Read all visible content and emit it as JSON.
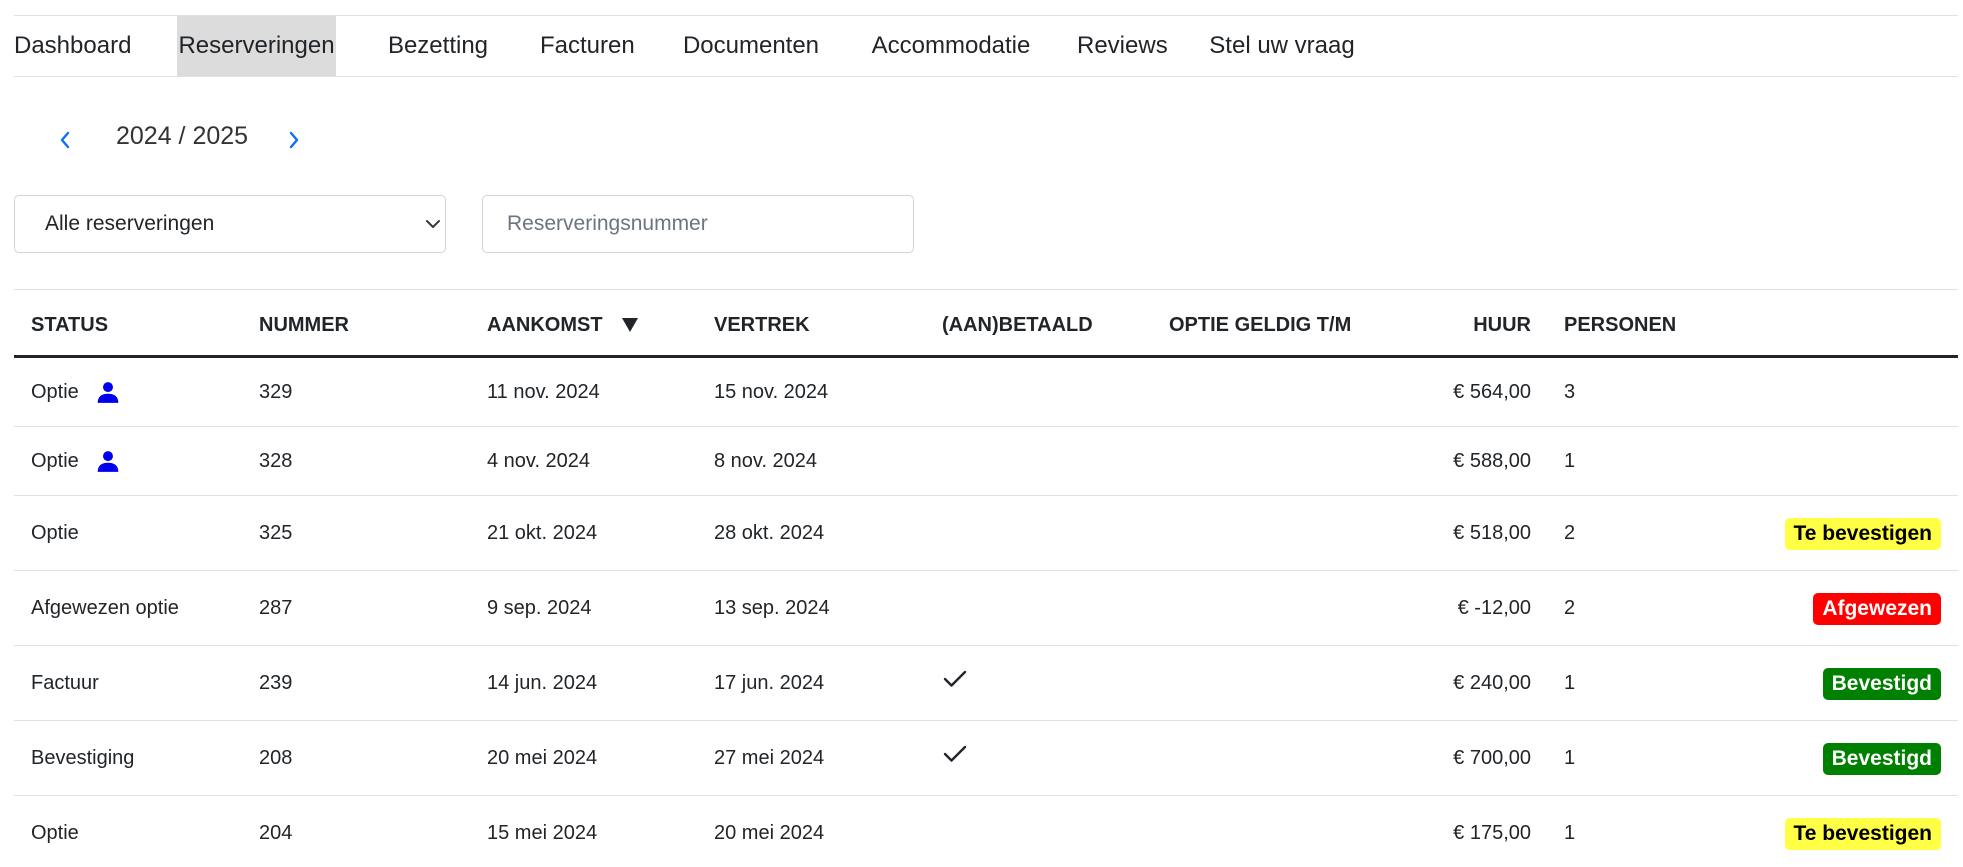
{
  "nav": {
    "tabs": [
      {
        "label": "Dashboard"
      },
      {
        "label": "Reserveringen"
      },
      {
        "label": "Bezetting"
      },
      {
        "label": "Facturen"
      },
      {
        "label": "Documenten"
      },
      {
        "label": "Accommodatie"
      },
      {
        "label": "Reviews"
      },
      {
        "label": "Stel uw vraag"
      }
    ],
    "active_tab": "Reserveringen"
  },
  "season": {
    "label": "2024 / 2025",
    "prev_icon": "chevron-left-icon",
    "next_icon": "chevron-right-icon"
  },
  "filters": {
    "status_select": {
      "selected": "Alle reserveringen"
    },
    "search": {
      "placeholder": "Reserveringsnummer",
      "value": ""
    }
  },
  "table": {
    "headers": {
      "status": "Status",
      "nummer": "Nummer",
      "aankomst": "Aankomst",
      "vertrek": "Vertrek",
      "betaald": "(Aan)betaald",
      "optie": "Optie geldig t/m",
      "huur": "Huur",
      "personen": "Personen"
    },
    "sort": {
      "column": "aankomst",
      "direction": "desc",
      "icon": "sort-down-icon"
    },
    "rows": [
      {
        "status": "Optie",
        "owner_icon": true,
        "nummer": "329",
        "aankomst": "11 nov. 2024",
        "vertrek": "15 nov. 2024",
        "betaald": false,
        "huur": "€ 564,00",
        "personen": "3",
        "badge": null
      },
      {
        "status": "Optie",
        "owner_icon": true,
        "nummer": "328",
        "aankomst": "4 nov. 2024",
        "vertrek": "8 nov. 2024",
        "betaald": false,
        "huur": "€ 588,00",
        "personen": "1",
        "badge": null
      },
      {
        "status": "Optie",
        "owner_icon": false,
        "nummer": "325",
        "aankomst": "21 okt. 2024",
        "vertrek": "28 okt. 2024",
        "betaald": false,
        "huur": "€ 518,00",
        "personen": "2",
        "badge": {
          "label": "Te bevestigen",
          "bg": "#ffff45",
          "fg": "#000000"
        }
      },
      {
        "status": "Afgewezen optie",
        "owner_icon": false,
        "nummer": "287",
        "aankomst": "9 sep. 2024",
        "vertrek": "13 sep. 2024",
        "betaald": false,
        "huur": "€ -12,00",
        "personen": "2",
        "badge": {
          "label": "Afgewezen",
          "bg": "#ff0000",
          "fg": "#ffffff"
        }
      },
      {
        "status": "Factuur",
        "owner_icon": false,
        "nummer": "239",
        "aankomst": "14 jun. 2024",
        "vertrek": "17 jun. 2024",
        "betaald": true,
        "huur": "€ 240,00",
        "personen": "1",
        "badge": {
          "label": "Bevestigd",
          "bg": "#008000",
          "fg": "#ffffff"
        }
      },
      {
        "status": "Bevestiging",
        "owner_icon": false,
        "nummer": "208",
        "aankomst": "20 mei 2024",
        "vertrek": "27 mei 2024",
        "betaald": true,
        "huur": "€ 700,00",
        "personen": "1",
        "badge": {
          "label": "Bevestigd",
          "bg": "#008000",
          "fg": "#ffffff"
        }
      },
      {
        "status": "Optie",
        "owner_icon": false,
        "nummer": "204",
        "aankomst": "15 mei 2024",
        "vertrek": "20 mei 2024",
        "betaald": false,
        "huur": "€ 175,00",
        "personen": "1",
        "badge": {
          "label": "Te bevestigen",
          "bg": "#ffff45",
          "fg": "#000000"
        }
      }
    ]
  },
  "colors": {
    "accent": "#0000ee",
    "chevron": "#0d6efd",
    "active_tab_bg": "#dcdcdc"
  }
}
